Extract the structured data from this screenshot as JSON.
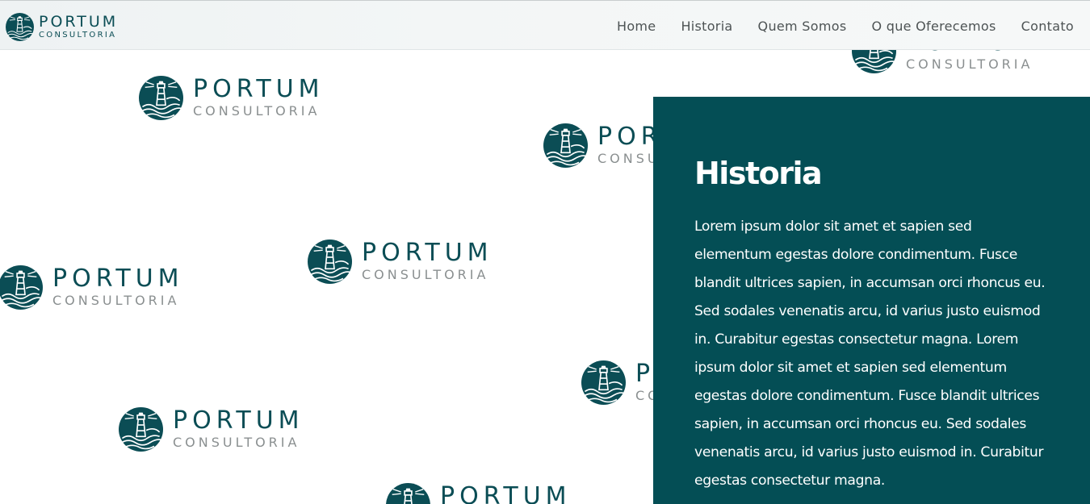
{
  "brand": {
    "name": "PORTUM",
    "subtitle": "CONSULTORIA"
  },
  "nav": {
    "items": [
      {
        "label": "Home"
      },
      {
        "label": "Historia"
      },
      {
        "label": "Quem Somos"
      },
      {
        "label": "O que Oferecemos"
      },
      {
        "label": "Contato"
      }
    ]
  },
  "panel": {
    "title": "Historia",
    "text": "Lorem ipsum dolor sit amet et sapien sed elementum egestas dolore condimentum. Fusce blandit ultrices sapien, in accumsan orci rhoncus eu. Sed sodales venenatis arcu, id varius justo euismod in. Curabitur egestas consectetur magna. Lorem ipsum dolor sit amet et sapien sed elementum egestas dolore condimentum. Fusce blandit ultrices sapien, in accumsan orci rhoncus eu. Sed sodales venenatis arcu, id varius justo euismod in. Curabitur egestas consectetur magna."
  },
  "colors": {
    "brand_teal": "#0b4d55",
    "panel_background": "#044e55",
    "subtitle_gray": "#8a8f90",
    "nav_text": "#4d5354"
  },
  "icons": {
    "logo": "lighthouse-logo-icon"
  }
}
